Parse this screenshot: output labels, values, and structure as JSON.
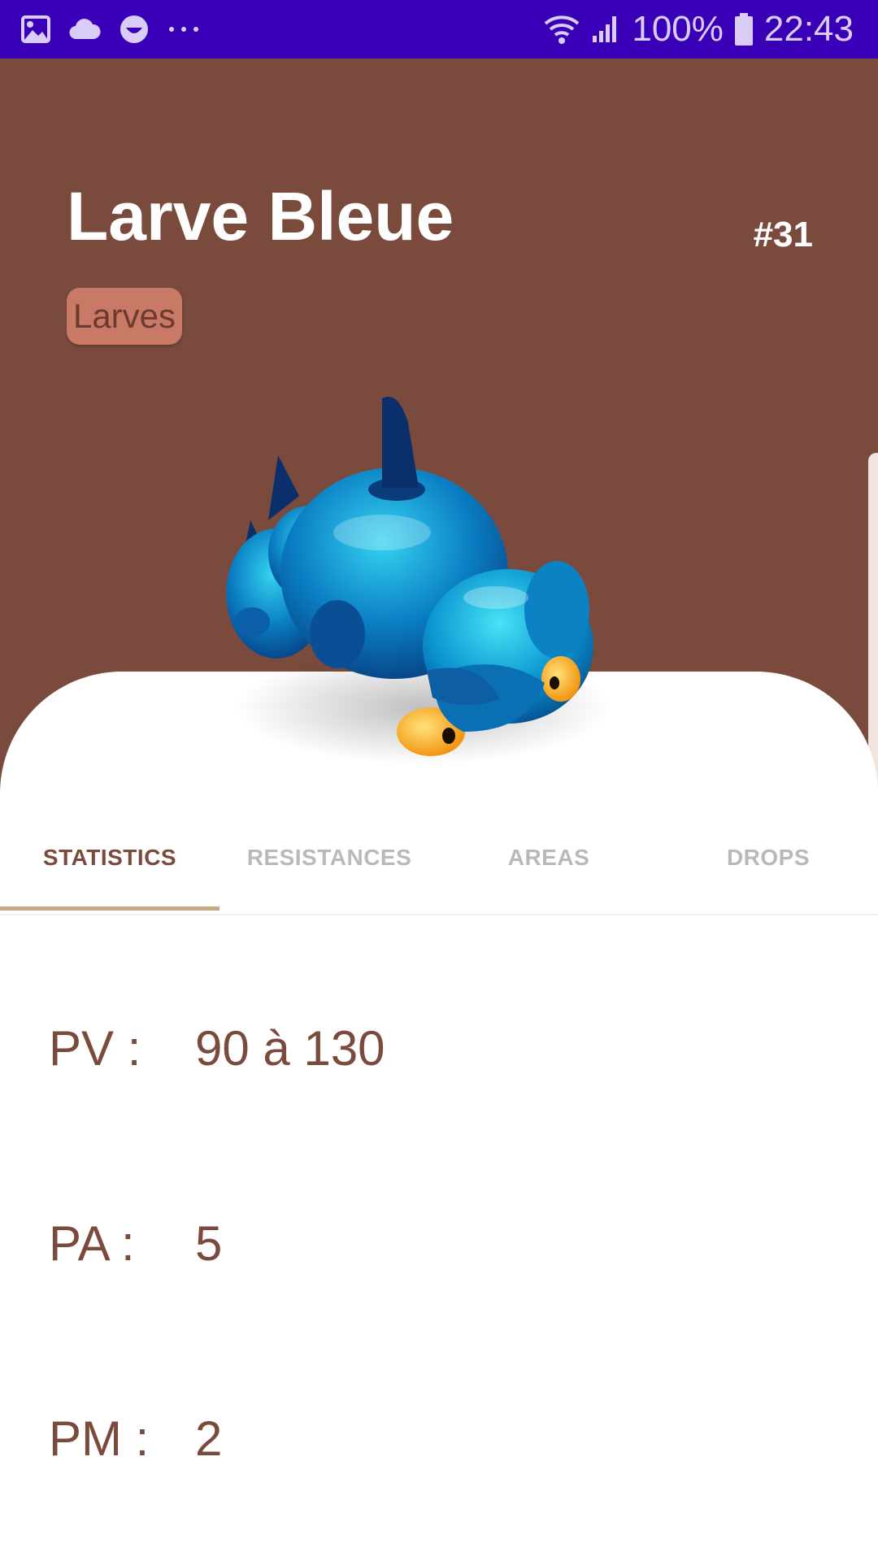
{
  "status_bar": {
    "icons_left": [
      "image-icon",
      "cloud-icon",
      "smiley-icon",
      "more-dots-icon"
    ],
    "icons_right": [
      "wifi-icon",
      "signal-icon",
      "battery-icon"
    ],
    "battery": "100%",
    "time": "22:43",
    "background": "#3a00b8"
  },
  "monster": {
    "name": "Larve Bleue",
    "number": "#31",
    "family": "Larves",
    "header_color": "#7a4b3d",
    "chip_color": "#c97a66"
  },
  "tabs": [
    {
      "label": "STATISTICS",
      "active": true
    },
    {
      "label": "RESISTANCES",
      "active": false
    },
    {
      "label": "AREAS",
      "active": false
    },
    {
      "label": "DROPS",
      "active": false
    }
  ],
  "stats": [
    {
      "label": "PV :",
      "value": "90 à 130"
    },
    {
      "label": "PA :",
      "value": "5"
    },
    {
      "label": "PM :",
      "value": "2"
    }
  ]
}
